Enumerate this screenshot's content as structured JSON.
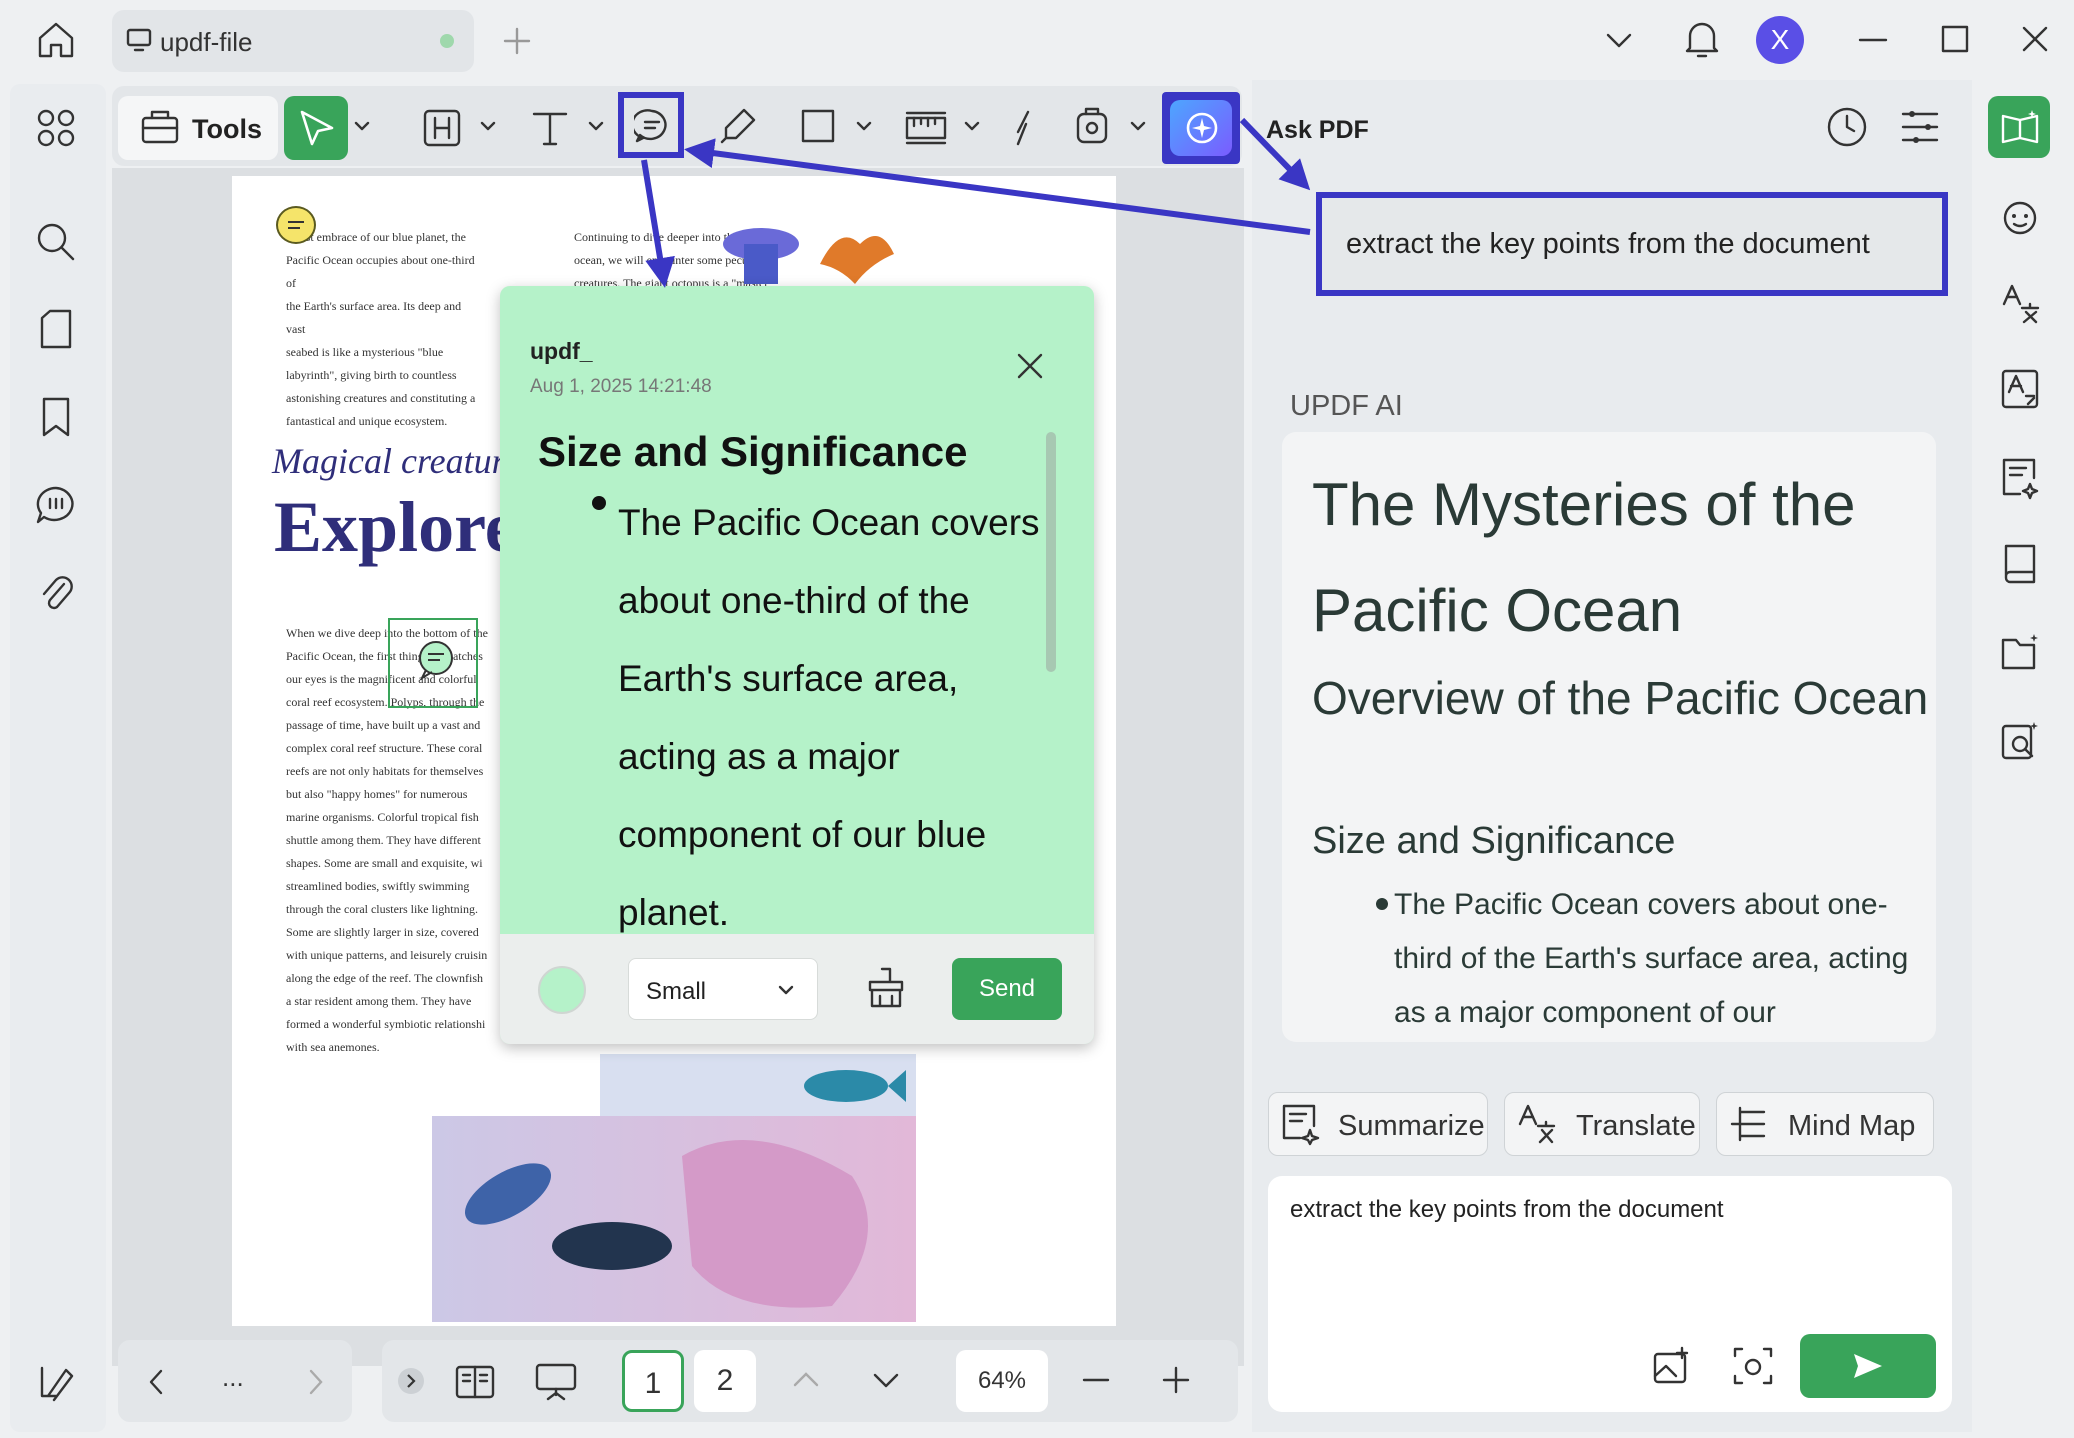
{
  "titlebar": {
    "tab_title": "updf-file",
    "avatar_letter": "X",
    "colors": {
      "avatar": "#5a4fe6",
      "tab_dot": "#9fd8ac"
    }
  },
  "toolbar": {
    "tools_label": "Tools",
    "accent": "#39a45a",
    "highlight": "#3a36c4"
  },
  "document": {
    "col1_para1": [
      "a vast embrace of our blue planet, the",
      "Pacific Ocean occupies about one-third of",
      "the Earth's surface area. Its deep and vast",
      "seabed is like a mysterious \"blue",
      "labyrinth\", giving birth to countless",
      "astonishing creatures and constituting a",
      "fantastical and unique ecosystem."
    ],
    "col2_para1": [
      "Continuing to dive deeper into the",
      "ocean, we will encounter some peculiar",
      "creatures. The giant octopus is a \"master of"
    ],
    "magical": "Magical creatur",
    "explore": "Explore",
    "col1_para2": [
      "When we dive deep into the bottom of the",
      "Pacific Ocean, the first thing that catches",
      "our eyes is the magnificent and colorful",
      "coral reef ecosystem. Polyps, through the",
      "passage of time, have built up a vast and",
      "complex coral reef structure. These coral",
      "reefs are not only habitats for themselves",
      "but also \"happy homes\" for numerous",
      "marine organisms. Colorful tropical fish",
      "shuttle among them. They have different",
      "shapes. Some are small and exquisite, wi",
      "streamlined bodies, swiftly swimming",
      "through the coral clusters like lightning.",
      "Some are slightly larger in size, covered",
      "with unique patterns, and leisurely cruisin",
      "along the edge of the reef. The clownfish",
      "a star resident among them. They have",
      "formed a wonderful symbiotic relationshi",
      "with sea anemones."
    ]
  },
  "note": {
    "author": "updf_",
    "date": "Aug 1, 2025 14:21:48",
    "heading": "Size and Significance",
    "body_lines": [
      "The Pacific Ocean covers",
      "about one-third of the",
      "Earth's surface area,",
      "acting as a major",
      "component of our blue",
      "planet."
    ],
    "size_option": "Small",
    "send_label": "Send",
    "bg_color": "#b5f2c9"
  },
  "bottombar": {
    "more": "...",
    "page_1": "1",
    "page_2": "2",
    "zoom": "64%"
  },
  "ai_panel": {
    "ask_pdf": "Ask PDF",
    "prompt": "extract the key points from the document",
    "section_label": "UPDF AI",
    "h1": "The Mysteries of the Pacific Ocean",
    "h2": "Overview of the Pacific Ocean",
    "h3": "Size and Significance",
    "bullet": "The Pacific Ocean covers about one-third of the Earth's surface area, acting as a major component of our",
    "summarize": "Summarize",
    "translate": "Translate",
    "mind_map": "Mind Map",
    "input_value": "extract the key points from the document"
  }
}
